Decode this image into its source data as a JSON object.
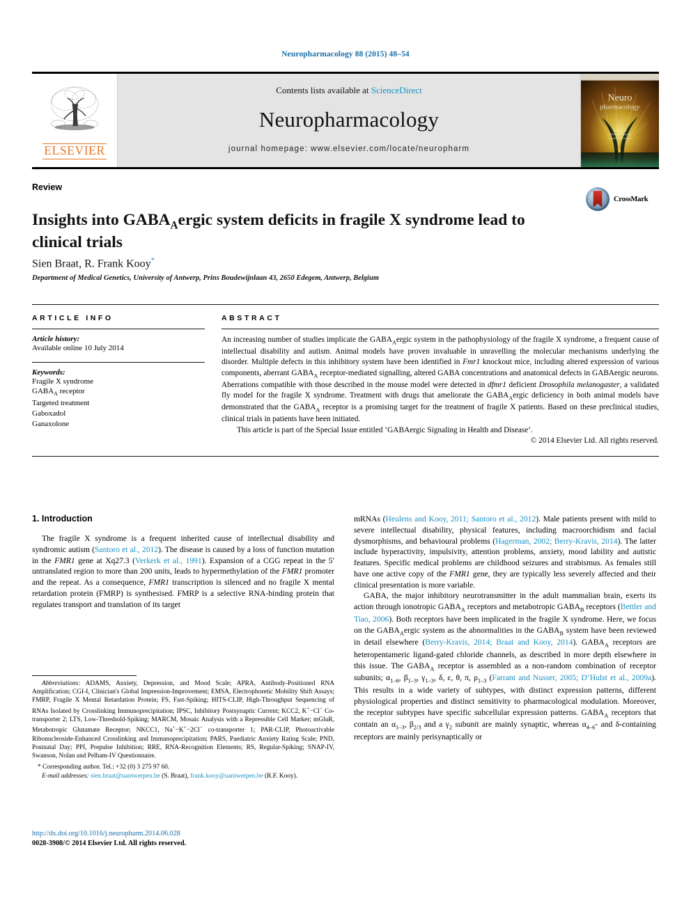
{
  "running_head": "Neuropharmacology 88 (2015) 48–54",
  "masthead": {
    "publisher_name": "ELSEVIER",
    "contents_prefix": "Contents lists available at ",
    "contents_link": "ScienceDirect",
    "journal_title": "Neuropharmacology",
    "homepage": "journal homepage: www.elsevier.com/locate/neuropharm",
    "cover_title_line1": "Neuro",
    "cover_title_line2": "pharmacology"
  },
  "article": {
    "type": "Review",
    "title_part1": "Insights into GABA",
    "title_sub": "A",
    "title_part2": "ergic system deficits in fragile X syndrome lead to clinical trials",
    "authors": "Sien Braat, R. Frank Kooy",
    "author_marker": "*",
    "affiliation": "Department of Medical Genetics, University of Antwerp, Prins Boudewijnlaan 43, 2650 Edegem, Antwerp, Belgium",
    "crossmark_label": "CrossMark"
  },
  "article_info": {
    "heading": "ARTICLE INFO",
    "history_label": "Article history:",
    "history_value": "Available online 10 July 2014",
    "keywords_label": "Keywords:",
    "keywords": [
      "Fragile X syndrome",
      "GABA_A receptor",
      "Targeted treatment",
      "Gaboxadol",
      "Ganaxolone"
    ]
  },
  "abstract": {
    "heading": "ABSTRACT",
    "paragraph": "An increasing number of studies implicate the GABAAergic system in the pathophysiology of the fragile X syndrome, a frequent cause of intellectual disability and autism. Animal models have proven invaluable in unravelling the molecular mechanisms underlying the disorder. Multiple defects in this inhibitory system have been identified in Fmr1 knockout mice, including altered expression of various components, aberrant GABAA receptor-mediated signalling, altered GABA concentrations and anatomical defects in GABAergic neurons. Aberrations compatible with those described in the mouse model were detected in dfmr1 deficient Drosophila melanogaster, a validated fly model for the fragile X syndrome. Treatment with drugs that ameliorate the GABAAergic deficiency in both animal models have demonstrated that the GABAA receptor is a promising target for the treatment of fragile X patients. Based on these preclinical studies, clinical trials in patients have been initiated.",
    "special_issue": "This article is part of the Special Issue entitled ‘GABAergic Signaling in Health and Disease’.",
    "copyright": "© 2014 Elsevier Ltd. All rights reserved."
  },
  "body": {
    "section_title": "1. Introduction",
    "left_paragraph": "The fragile X syndrome is a frequent inherited cause of intellectual disability and syndromic autism (Santoro et al., 2012). The disease is caused by a loss of function mutation in the FMR1 gene at Xq27.3 (Verkerk et al., 1991). Expansion of a CGG repeat in the 5′ untranslated region to more than 200 units, leads to hypermethylation of the FMR1 promoter and the repeat. As a consequence, FMR1 transcription is silenced and no fragile X mental retardation protein (FMRP) is synthesised. FMRP is a selective RNA-binding protein that regulates transport and translation of its target",
    "right_paragraph_1": "mRNAs (Heulens and Kooy, 2011; Santoro et al., 2012). Male patients present with mild to severe intellectual disability, physical features, including macroorchidism and facial dysmorphisms, and behavioural problems (Hagerman, 2002; Berry-Kravis, 2014). The latter include hyperactivity, impulsivity, attention problems, anxiety, mood lability and autistic features. Specific medical problems are childhood seizures and strabismus. As females still have one active copy of the FMR1 gene, they are typically less severely affected and their clinical presentation is more variable.",
    "right_paragraph_2": "GABA, the major inhibitory neurotransmitter in the adult mammalian brain, exerts its action through ionotropic GABAA receptors and metabotropic GABAB receptors (Bettler and Tiao, 2006). Both receptors have been implicated in the fragile X syndrome. Here, we focus on the GABAAergic system as the abnormalities in the GABAB system have been reviewed in detail elsewhere (Berry-Kravis, 2014; Braat and Kooy, 2014). GABAA receptors are heteropentameric ligand-gated chloride channels, as described in more depth elsewhere in this issue. The GABAA receptor is assembled as a non-random combination of receptor subunits; α1–6, β1–3, γ1–3, δ, ε, θ, π, ρ1–3 (Farrant and Nusser, 2005; D’Hulst et al., 2009a). This results in a wide variety of subtypes, with distinct expression patterns, different physiological properties and distinct sensitivity to pharmacological modulation. Moreover, the receptor subtypes have specific subcellular expression patterns. GABAA receptors that contain an α1–3, β2/3 and a γ2 subunit are mainly synaptic, whereas α4–6- and δ-containing receptors are mainly perisynaptically or"
  },
  "footnotes": {
    "abbreviations_label": "Abbreviations:",
    "abbreviations_text": "ADAMS, Anxiety, Depression, and Mood Scale; APRA, Antibody-Positioned RNA Amplification; CGI-I, Clinician's Global Impression-Improvement; EMSA, Electrophoretic Mobility Shift Assays; FMRP, Fragile X Mental Retardation Protein; FS, Fast-Spiking; HITS-CLIP, High-Throughput Sequencing of RNAs Isolated by Crosslinking Immunoprecipitation; IPSC, Inhibitory Postsynaptic Current; KCC2, K+−Cl− Co-transporter 2; LTS, Low-Threshold-Spiking; MARCM, Mosaic Analysis with a Repressible Cell Marker; mGluR, Metabotropic Glutamate Receptor; NKCC1, Na+−K+−2Cl− co-transporter 1; PAR-CLIP, Photoactivable Ribonucleoside-Enhanced Crosslinking and Immunoprecipitation; PARS, Paediatric Anxiety Rating Scale; PND, Postnatal Day; PPI, Prepulse Inhibition; RRE, RNA-Recognition Elements; RS, Regular-Spiking; SNAP-IV, Swanson, Nolan and Pelham-IV Questionnaire.",
    "corresponding": "Corresponding author. Tel.: +32 (0) 3 275 97 60.",
    "email_label": "E-mail addresses:",
    "email_1": "sien.braat@uantwerpen.be",
    "email_1_owner": "(S. Braat),",
    "email_2": "frank.kooy@uantwerpen.be",
    "email_2_owner": "(R.F. Kooy).",
    "doi": "http://dx.doi.org/10.1016/j.neuropharm.2014.06.028",
    "issn_line": "0028-3908/© 2014 Elsevier Ltd. All rights reserved."
  },
  "colors": {
    "link_blue": "#1a8fc1",
    "header_blue": "#1a6ea8",
    "elsevier_orange": "#E87722",
    "masthead_grey": "#e4e4e4"
  }
}
